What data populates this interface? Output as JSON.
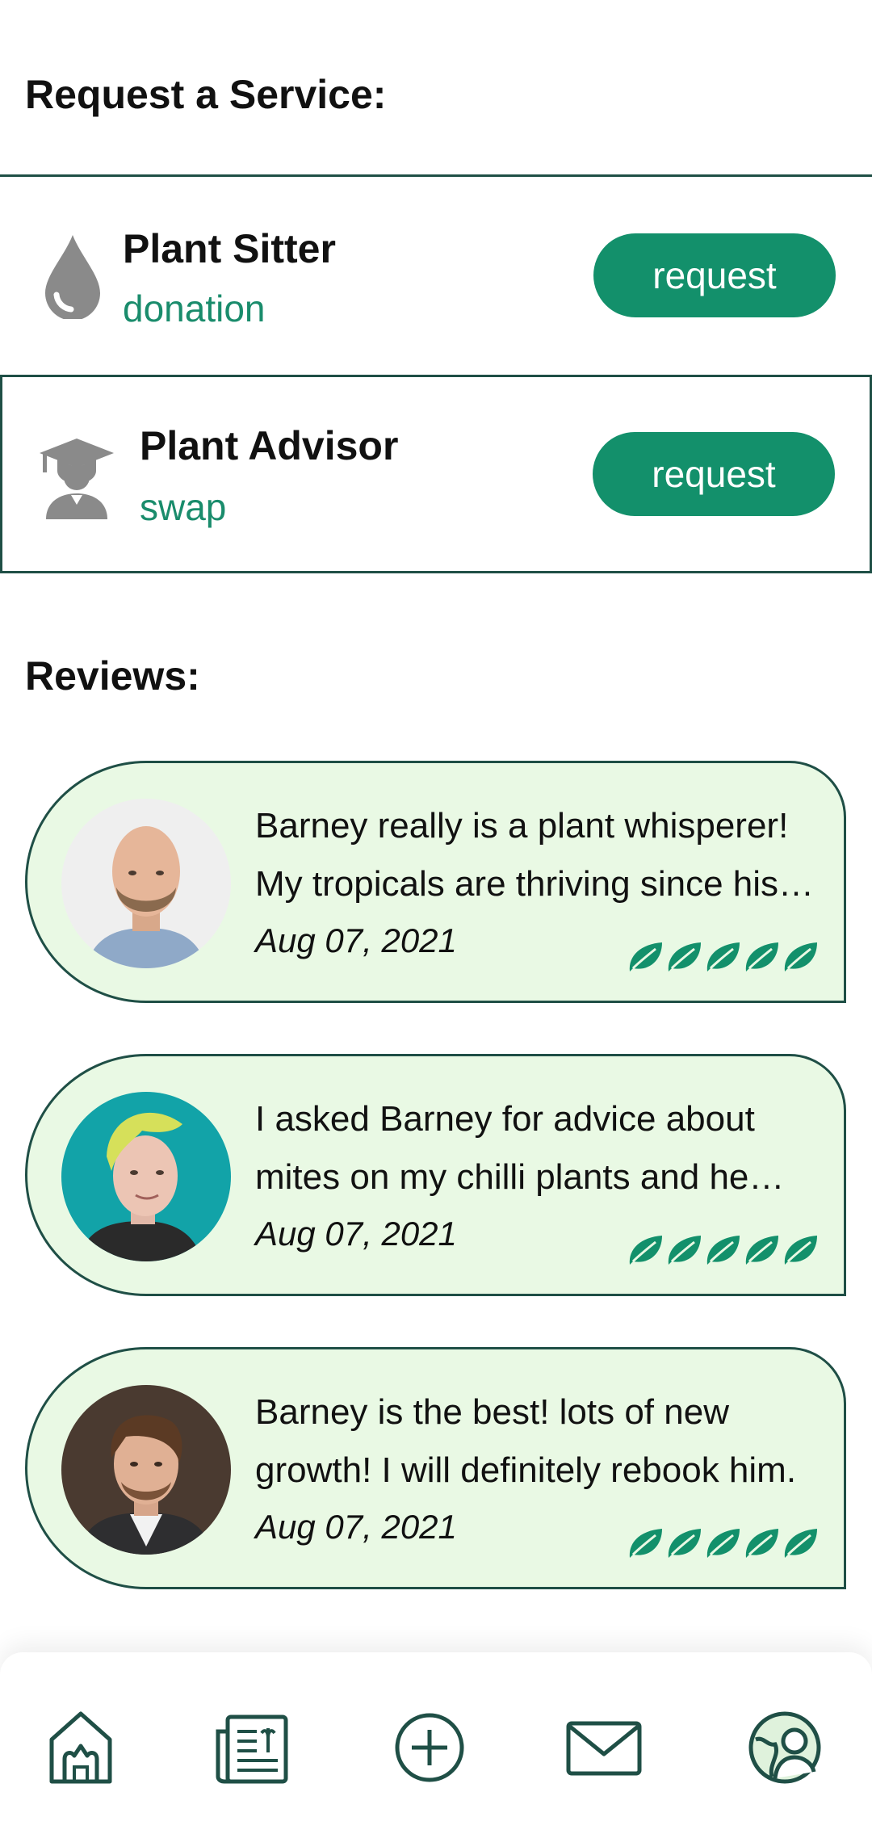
{
  "services": {
    "title": "Request a Service:",
    "items": [
      {
        "name": "Plant Sitter",
        "type": "donation",
        "button_label": "request",
        "icon": "water-drop-icon"
      },
      {
        "name": "Plant Advisor",
        "type": "swap",
        "button_label": "request",
        "icon": "graduate-icon"
      }
    ]
  },
  "reviews": {
    "title": "Reviews:",
    "items": [
      {
        "text": "Barney really is a plant whisperer! My tropicals are thriving since his visit.",
        "date": "Aug 07, 2021",
        "rating": 5
      },
      {
        "text": "I asked Barney for advice about mites on my chilli plants and he helped me get rid of them.",
        "date": "Aug 07, 2021",
        "rating": 5
      },
      {
        "text": "Barney is the best! lots of new growth! I will definitely rebook him.",
        "date": "Aug 07, 2021",
        "rating": 5
      }
    ]
  },
  "nav": {
    "items": [
      "home-icon",
      "newspaper-icon",
      "add-circle-icon",
      "mail-icon",
      "profile-globe-icon"
    ]
  },
  "colors": {
    "accent": "#13906b",
    "dark_green": "#1f4f46",
    "card_bg": "#e9f9e4",
    "icon_gray": "#8a8a8a"
  }
}
